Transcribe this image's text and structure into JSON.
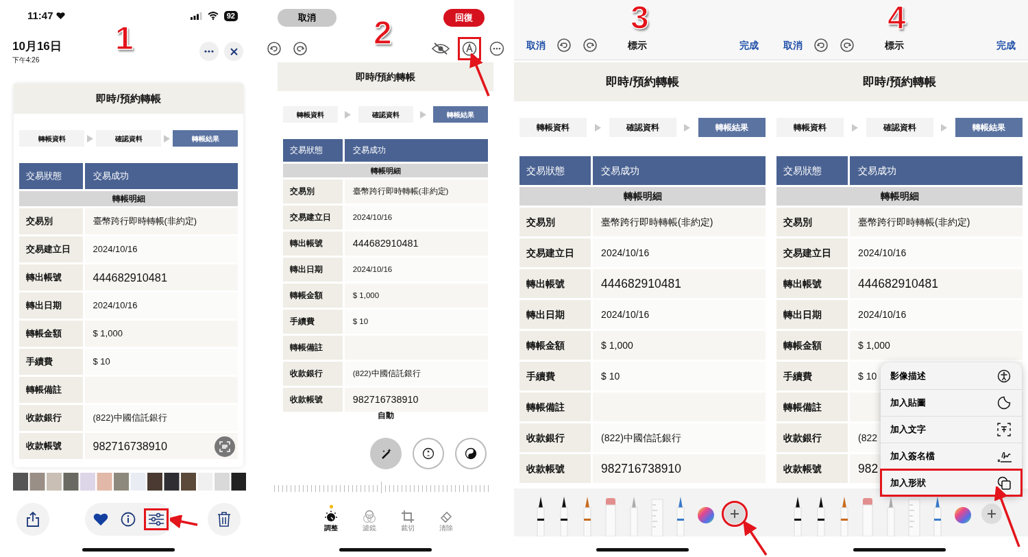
{
  "panels": [
    {
      "kind": "photo_view",
      "step_number": "1",
      "status_bar": {
        "time": "11:47",
        "battery": "92"
      },
      "date": "10月16日",
      "time": "下午4:26",
      "card": {
        "title": "即時/預約轉帳",
        "steps": [
          {
            "label": "轉帳資料",
            "selected": false
          },
          {
            "label": "確認資料",
            "selected": false
          },
          {
            "label": "轉帳結果",
            "selected": true
          }
        ],
        "status_label": "交易狀態",
        "status_value": "交易成功",
        "section": "轉帳明細",
        "rows": [
          {
            "kind": "text",
            "label": "交易別",
            "value": "臺幣跨行即時轉帳(非約定)"
          },
          {
            "kind": "text",
            "label": "交易建立日",
            "value": "2024/10/16"
          },
          {
            "kind": "account",
            "label": "轉出帳號",
            "value": "444682910481"
          },
          {
            "kind": "text",
            "label": "轉出日期",
            "value": "2024/10/16"
          },
          {
            "kind": "text",
            "label": "轉帳金額",
            "value": "$ 1,000"
          },
          {
            "kind": "text",
            "label": "手續費",
            "value": "$ 10"
          },
          {
            "kind": "text",
            "label": "轉帳備註"
          },
          {
            "kind": "text",
            "label": "收款銀行",
            "value": "(822)中國信託銀行"
          },
          {
            "kind": "account",
            "label": "收款帳號",
            "value": "982716738910"
          }
        ]
      },
      "toolbar": {
        "favorited": true,
        "edit_highlighted": true
      }
    },
    {
      "kind": "photo_edit",
      "step_number": "2",
      "cancel": "取消",
      "revert": "回復",
      "markup_highlighted": true,
      "card": {
        "title": "即時/預約轉帳",
        "steps": [
          {
            "label": "轉帳資料",
            "selected": false
          },
          {
            "label": "確認資料",
            "selected": false
          },
          {
            "label": "轉帳結果",
            "selected": true
          }
        ],
        "status_label": "交易狀態",
        "status_value": "交易成功",
        "section": "轉帳明細",
        "rows": [
          {
            "kind": "text",
            "label": "交易別",
            "value": "臺幣跨行即時轉帳(非約定)"
          },
          {
            "kind": "text",
            "label": "交易建立日",
            "value": "2024/10/16"
          },
          {
            "kind": "account",
            "label": "轉出帳號",
            "value": "444682910481"
          },
          {
            "kind": "text",
            "label": "轉出日期",
            "value": "2024/10/16"
          },
          {
            "kind": "text",
            "label": "轉帳金額",
            "value": "$ 1,000"
          },
          {
            "kind": "text",
            "label": "手續費",
            "value": "$ 10"
          },
          {
            "kind": "text",
            "label": "轉帳備註"
          },
          {
            "kind": "text",
            "label": "收款銀行",
            "value": "(822)中國信託銀行"
          },
          {
            "kind": "account",
            "label": "收款帳號",
            "value": "982716738910"
          }
        ]
      },
      "auto_label": "自動",
      "adjust_tools": [
        {
          "kind": "auto",
          "selected": true
        },
        {
          "kind": "exposure",
          "selected": false
        },
        {
          "kind": "brilliance",
          "selected": false
        }
      ],
      "tabs": [
        {
          "label": "調整",
          "selected": true
        },
        {
          "label": "濾鏡",
          "selected": false
        },
        {
          "label": "裁切",
          "selected": false
        },
        {
          "label": "清除",
          "selected": false
        }
      ]
    },
    {
      "kind": "markup",
      "step_number": "3",
      "cancel": "取消",
      "title": "標示",
      "done": "完成",
      "add_highlighted": true,
      "card": {
        "title": "即時/預約轉帳",
        "steps": [
          {
            "label": "轉帳資料",
            "selected": false
          },
          {
            "label": "確認資料",
            "selected": false
          },
          {
            "label": "轉帳結果",
            "selected": true
          }
        ],
        "status_label": "交易狀態",
        "status_value": "交易成功",
        "section": "轉帳明細",
        "rows": [
          {
            "kind": "text",
            "label": "交易別",
            "value": "臺幣跨行即時轉帳(非約定)"
          },
          {
            "kind": "text",
            "label": "交易建立日",
            "value": "2024/10/16"
          },
          {
            "kind": "account",
            "label": "轉出帳號",
            "value": "444682910481"
          },
          {
            "kind": "text",
            "label": "轉出日期",
            "value": "2024/10/16"
          },
          {
            "kind": "text",
            "label": "轉帳金額",
            "value": "$ 1,000"
          },
          {
            "kind": "text",
            "label": "手續費",
            "value": "$ 10"
          },
          {
            "kind": "text",
            "label": "轉帳備註"
          },
          {
            "kind": "text",
            "label": "收款銀行",
            "value": "(822)中國信託銀行"
          },
          {
            "kind": "account",
            "label": "收款帳號",
            "value": "982716738910"
          }
        ]
      }
    },
    {
      "kind": "markup",
      "step_number": "4",
      "cancel": "取消",
      "title": "標示",
      "done": "完成",
      "add_highlighted": false,
      "card": {
        "title": "即時/預約轉帳",
        "steps": [
          {
            "label": "轉帳資料",
            "selected": false
          },
          {
            "label": "確認資料",
            "selected": false
          },
          {
            "label": "轉帳結果",
            "selected": true
          }
        ],
        "status_label": "交易狀態",
        "status_value": "交易成功",
        "section": "轉帳明細",
        "rows": [
          {
            "kind": "text",
            "label": "交易別",
            "value": "臺幣跨行即時轉帳(非約定)"
          },
          {
            "kind": "text",
            "label": "交易建立日",
            "value": "2024/10/16"
          },
          {
            "kind": "account",
            "label": "轉出帳號",
            "value": "444682910481"
          },
          {
            "kind": "text",
            "label": "轉出日期",
            "value": "2024/10/16"
          },
          {
            "kind": "text",
            "label": "轉帳金額",
            "value": "$ 1,000"
          },
          {
            "kind": "text",
            "label": "手續費",
            "value": "$ 10"
          },
          {
            "kind": "text",
            "label": "轉帳備註"
          },
          {
            "kind": "text",
            "label": "收款銀行",
            "value": "(822"
          },
          {
            "kind": "account",
            "label": "收款帳號",
            "value": "982"
          }
        ]
      },
      "menu": [
        {
          "kind": "description",
          "label": "影像描述",
          "highlighted": false
        },
        {
          "kind": "sticker",
          "label": "加入貼圖",
          "highlighted": false
        },
        {
          "kind": "text",
          "label": "加入文字",
          "highlighted": false
        },
        {
          "kind": "signature",
          "label": "加入簽名檔",
          "highlighted": false
        },
        {
          "kind": "shape",
          "label": "加入形狀",
          "highlighted": true
        }
      ]
    }
  ]
}
